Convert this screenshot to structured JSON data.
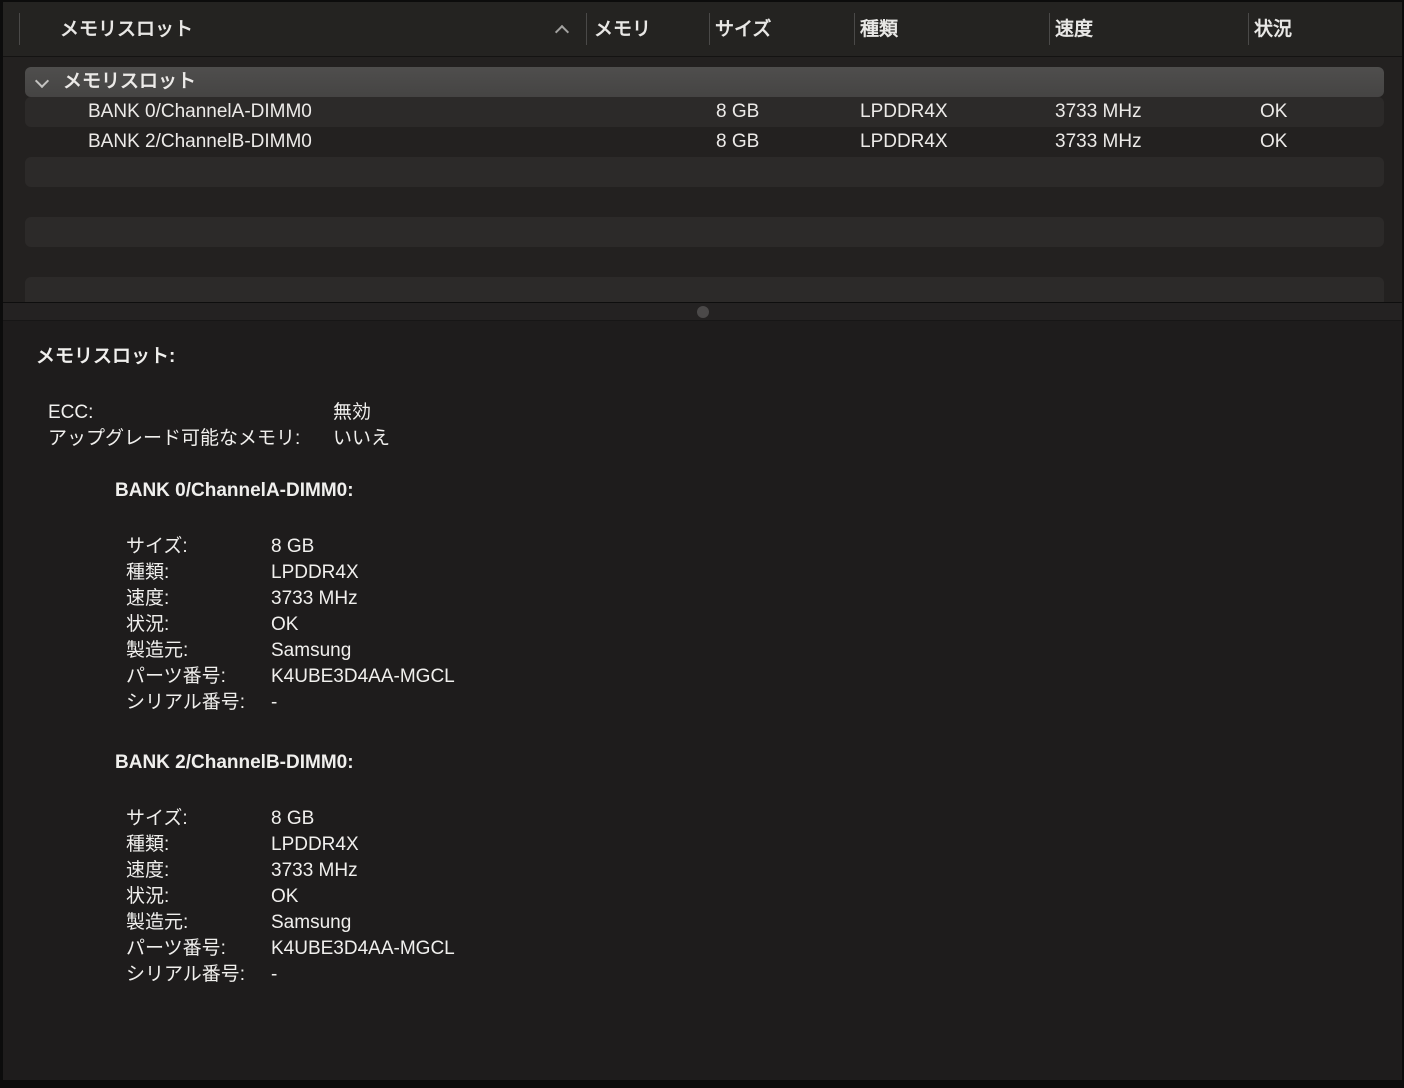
{
  "colors": {
    "window_frame": "#0c0c0c",
    "header_bg": "#242321",
    "table_bg": "#232120",
    "row_stripe": "#2c2a29",
    "group_bar": "#4a4948",
    "splitter_bg": "#242222",
    "detail_bg": "#1e1c1c",
    "text": "#eceae8"
  },
  "header": {
    "sort_icon": "chevron-up",
    "columns": [
      {
        "label": "メモリスロット",
        "sorted": "ascending"
      },
      {
        "label": "メモリ"
      },
      {
        "label": "サイズ"
      },
      {
        "label": "種類"
      },
      {
        "label": "速度"
      },
      {
        "label": "状況"
      }
    ]
  },
  "table": {
    "group": {
      "label": "メモリスロット",
      "expanded": true,
      "disclosure_icon": "chevron-down"
    },
    "rows": [
      {
        "name": "BANK 0/ChannelA-DIMM0",
        "memory": "",
        "size": "8 GB",
        "type": "LPDDR4X",
        "speed": "3733 MHz",
        "status": "OK"
      },
      {
        "name": "BANK 2/ChannelB-DIMM0",
        "memory": "",
        "size": "8 GB",
        "type": "LPDDR4X",
        "speed": "3733 MHz",
        "status": "OK"
      }
    ],
    "empty_row_count": 5
  },
  "detail": {
    "title": "メモリスロット:",
    "summary": [
      {
        "key": "ECC:",
        "value": "無効"
      },
      {
        "key": "アップグレード可能なメモリ:",
        "value": "いいえ"
      }
    ],
    "banks": [
      {
        "heading": "BANK 0/ChannelA-DIMM0:",
        "fields": [
          {
            "key": "サイズ:",
            "value": "8 GB"
          },
          {
            "key": "種類:",
            "value": "LPDDR4X"
          },
          {
            "key": "速度:",
            "value": "3733 MHz"
          },
          {
            "key": "状況:",
            "value": "OK"
          },
          {
            "key": "製造元:",
            "value": "Samsung"
          },
          {
            "key": "パーツ番号:",
            "value": "K4UBE3D4AA-MGCL"
          },
          {
            "key": "シリアル番号:",
            "value": "-"
          }
        ]
      },
      {
        "heading": "BANK 2/ChannelB-DIMM0:",
        "fields": [
          {
            "key": "サイズ:",
            "value": "8 GB"
          },
          {
            "key": "種類:",
            "value": "LPDDR4X"
          },
          {
            "key": "速度:",
            "value": "3733 MHz"
          },
          {
            "key": "状況:",
            "value": "OK"
          },
          {
            "key": "製造元:",
            "value": "Samsung"
          },
          {
            "key": "パーツ番号:",
            "value": "K4UBE3D4AA-MGCL"
          },
          {
            "key": "シリアル番号:",
            "value": "-"
          }
        ]
      }
    ]
  }
}
